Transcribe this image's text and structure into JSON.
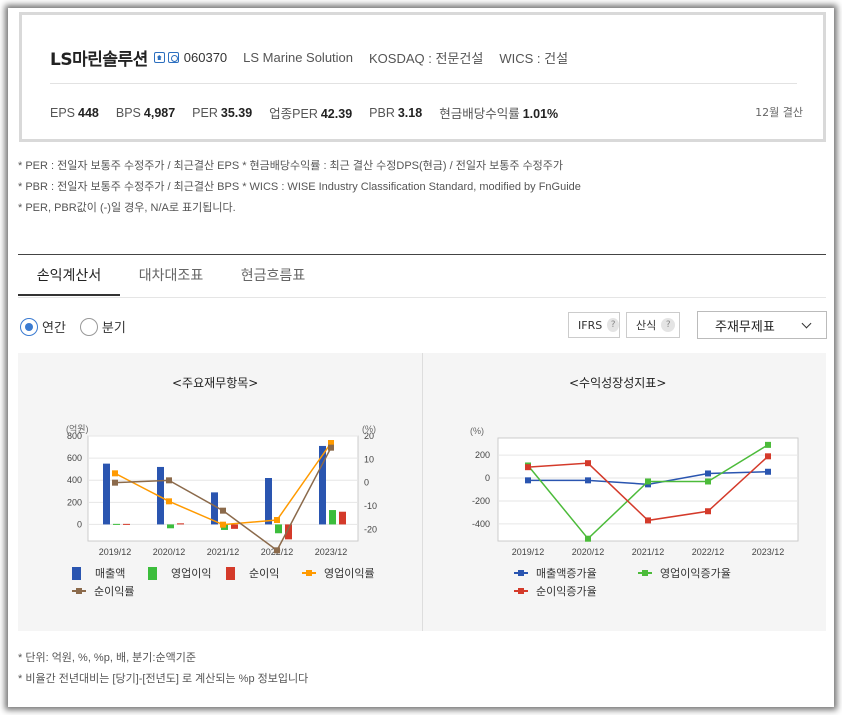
{
  "header": {
    "company_name": "LS마린솔루션",
    "icons": [
      "home-icon",
      "pin-icon"
    ],
    "code": "060370",
    "english_name": "LS Marine Solution",
    "market": "KOSDAQ : 전문건설",
    "wics": "WICS : 건설",
    "metrics": [
      {
        "label": "EPS",
        "value": "448"
      },
      {
        "label": "BPS",
        "value": "4,987"
      },
      {
        "label": "PER",
        "value": "35.39"
      },
      {
        "label": "업종PER",
        "value": "42.39"
      },
      {
        "label": "PBR",
        "value": "3.18"
      },
      {
        "label": "현금배당수익률",
        "value": "1.01%"
      }
    ],
    "fiscal_note": "12월 결산"
  },
  "notes": [
    "* PER : 전일자 보통주 수정주가 / 최근결산 EPS * 현금배당수익률 : 최근 결산 수정DPS(현금) / 전일자 보통주 수정주가",
    "* PBR : 전일자 보통주 수정주가 / 최근결산 BPS * WICS : WISE Industry Classification Standard, modified by FnGuide",
    "* PER, PBR값이 (-)일 경우, N/A로 표기됩니다."
  ],
  "tabs": [
    "손익계산서",
    "대차대조표",
    "현금흐름표"
  ],
  "period": {
    "annual": "연간",
    "quarterly": "분기",
    "selected": "연간"
  },
  "options": {
    "ifrs": "IFRS",
    "calc": "산식",
    "qmark": "?",
    "select_value": "주재무제표"
  },
  "colors": {
    "blue": "#2a55b0",
    "green": "#3cbd3c",
    "red": "#d43a2a",
    "orange": "#ff9a00",
    "brown": "#8b6a4b",
    "green2": "#4cbb3a"
  },
  "chart_data": [
    {
      "type": "bar",
      "title": "<주요재무항목>",
      "ylabel": "(억원)",
      "y2label": "(%)",
      "categories": [
        "2019/12",
        "2020/12",
        "2021/12",
        "2022/12",
        "2023/12"
      ],
      "ylim": [
        -150,
        800
      ],
      "yticks": [
        0,
        200,
        400,
        600,
        800
      ],
      "y2lim": [
        -25,
        20
      ],
      "y2ticks": [
        -20,
        -10,
        0,
        10,
        20
      ],
      "series": [
        {
          "name": "매출액",
          "type": "bar",
          "axis": "left",
          "values": [
            550,
            520,
            290,
            420,
            710
          ]
        },
        {
          "name": "영업이익",
          "type": "bar",
          "axis": "left",
          "values": [
            5,
            -35,
            -50,
            -80,
            130
          ]
        },
        {
          "name": "순이익",
          "type": "bar",
          "axis": "left",
          "values": [
            5,
            10,
            -40,
            -135,
            115
          ]
        },
        {
          "name": "영업이익률",
          "type": "line",
          "axis": "right",
          "values": [
            4,
            -8,
            -18,
            -16,
            17
          ]
        },
        {
          "name": "순이익률",
          "type": "line",
          "axis": "right",
          "values": [
            0,
            1,
            -12,
            -29,
            15
          ]
        }
      ],
      "legend": [
        "매출액",
        "영업이익",
        "순이익",
        "영업이익률",
        "순이익률"
      ]
    },
    {
      "type": "line",
      "title": "<수익성장성지표>",
      "ylabel": "(%)",
      "categories": [
        "2019/12",
        "2020/12",
        "2021/12",
        "2022/12",
        "2023/12"
      ],
      "ylim": [
        -550,
        350
      ],
      "yticks": [
        -400,
        -200,
        0,
        200
      ],
      "series": [
        {
          "name": "매출액증가율",
          "values": [
            -20,
            -20,
            -55,
            40,
            55
          ]
        },
        {
          "name": "영업이익증가율",
          "values": [
            110,
            -530,
            -30,
            -30,
            290
          ]
        },
        {
          "name": "순이익증가율",
          "values": [
            95,
            130,
            -370,
            -290,
            190
          ]
        }
      ],
      "legend": [
        "매출액증가율",
        "영업이익증가율",
        "순이익증가율"
      ]
    }
  ],
  "footer": [
    "* 단위: 억원, %, %p, 배, 분기:순액기준",
    "* 비율간 전년대비는 [당기]-[전년도] 로 계산되는 %p 정보입니다"
  ]
}
